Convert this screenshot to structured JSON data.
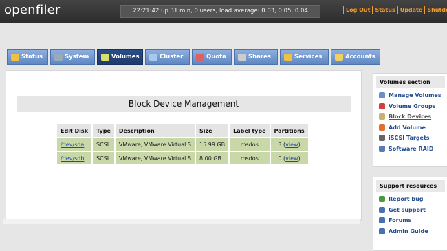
{
  "header": {
    "logo": "openfiler",
    "uptime": "22:21:42 up 31 min, 0 users, load average: 0.03, 0.05, 0.04",
    "links": [
      "Log Out",
      "Status",
      "Update",
      "Shutdown"
    ]
  },
  "tabs": [
    {
      "label": "Status",
      "icon": "status-icon",
      "color": "#f0c040"
    },
    {
      "label": "System",
      "icon": "system-icon",
      "color": "#9ab"
    },
    {
      "label": "Volumes",
      "icon": "volumes-icon",
      "color": "#d9e06a"
    },
    {
      "label": "Cluster",
      "icon": "cluster-icon",
      "color": "#a8c8f0"
    },
    {
      "label": "Quota",
      "icon": "quota-icon",
      "color": "#e06060"
    },
    {
      "label": "Shares",
      "icon": "shares-icon",
      "color": "#ccc"
    },
    {
      "label": "Services",
      "icon": "services-icon",
      "color": "#f0c040"
    },
    {
      "label": "Accounts",
      "icon": "accounts-icon",
      "color": "#f0d060"
    }
  ],
  "main": {
    "title": "Block Device Management",
    "columns": [
      "Edit Disk",
      "Type",
      "Description",
      "Size",
      "Label type",
      "Partitions"
    ],
    "rows": [
      {
        "disk": "/dev/sda",
        "type": "SCSI",
        "description": "VMware, VMware Virtual S",
        "size": "15.99 GB",
        "label": "msdos",
        "parts_pre": "3 (",
        "parts_link": "view",
        "parts_post": ")"
      },
      {
        "disk": "/dev/sdb",
        "type": "SCSI",
        "description": "VMware, VMware Virtual S",
        "size": "8.00 GB",
        "label": "msdos",
        "parts_pre": "0 (",
        "parts_link": "view",
        "parts_post": ")"
      }
    ]
  },
  "volumes_panel": {
    "title": "Volumes section",
    "items": [
      {
        "label": "Manage Volumes",
        "icon": "manage-volumes-icon",
        "color": "#6a8fc8"
      },
      {
        "label": "Volume Groups",
        "icon": "volume-groups-icon",
        "color": "#d04040"
      },
      {
        "label": "Block Devices",
        "icon": "block-devices-icon",
        "color": "#c8b070"
      },
      {
        "label": "Add Volume",
        "icon": "add-volume-icon",
        "color": "#e07030"
      },
      {
        "label": "iSCSI Targets",
        "icon": "iscsi-targets-icon",
        "color": "#666"
      },
      {
        "label": "Software RAID",
        "icon": "software-raid-icon",
        "color": "#5a7ab8"
      }
    ]
  },
  "support_panel": {
    "title": "Support resources",
    "items": [
      {
        "label": "Report bug",
        "icon": "bug-icon",
        "color": "#4a9a40"
      },
      {
        "label": "Get support",
        "icon": "support-icon",
        "color": "#4a70b0"
      },
      {
        "label": "Forums",
        "icon": "forums-icon",
        "color": "#4a70b0"
      },
      {
        "label": "Admin Guide",
        "icon": "guide-icon",
        "color": "#4a70b0"
      }
    ]
  }
}
